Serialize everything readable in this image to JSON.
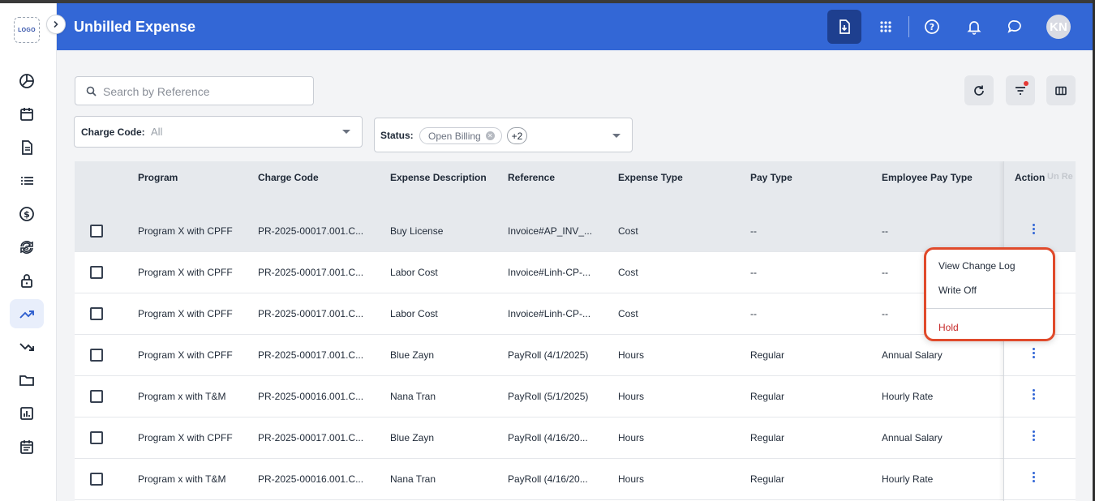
{
  "header": {
    "title": "Unbilled Expense",
    "avatar_initials": "KN",
    "accent_color": "#3367d6"
  },
  "sidebar": {
    "logo_text": "LOGO",
    "items": [
      {
        "icon": "pie-chart-icon"
      },
      {
        "icon": "calendar-icon"
      },
      {
        "icon": "document-icon"
      },
      {
        "icon": "list-icon"
      },
      {
        "icon": "dollar-icon"
      },
      {
        "icon": "currency-exchange-icon"
      },
      {
        "icon": "lock-icon"
      },
      {
        "icon": "trending-up-icon",
        "active": true
      },
      {
        "icon": "trending-down-icon"
      },
      {
        "icon": "folder-icon"
      },
      {
        "icon": "bar-report-icon"
      },
      {
        "icon": "schedule-icon"
      }
    ]
  },
  "search": {
    "placeholder": "Search by Reference",
    "value": ""
  },
  "filters": {
    "charge_code": {
      "label": "Charge Code:",
      "value": "All"
    },
    "status": {
      "label": "Status:",
      "chip": "Open Billing",
      "more": "+2"
    }
  },
  "table": {
    "columns": [
      "Program",
      "Charge Code",
      "Expense Description",
      "Reference",
      "Expense Type",
      "Pay Type",
      "Employee Pay Type",
      "Action"
    ],
    "hidden_column_hint": "Un Re",
    "rows": [
      {
        "program": "Program X with CPFF",
        "charge_code": "PR-2025-00017.001.C...",
        "description": "Buy License",
        "reference": "Invoice#AP_INV_...",
        "expense_type": "Cost",
        "pay_type": "--",
        "employee_pay_type": "--"
      },
      {
        "program": "Program X with CPFF",
        "charge_code": "PR-2025-00017.001.C...",
        "description": "Labor Cost",
        "reference": "Invoice#Linh-CP-...",
        "expense_type": "Cost",
        "pay_type": "--",
        "employee_pay_type": "--"
      },
      {
        "program": "Program X with CPFF",
        "charge_code": "PR-2025-00017.001.C...",
        "description": "Labor Cost",
        "reference": "Invoice#Linh-CP-...",
        "expense_type": "Cost",
        "pay_type": "--",
        "employee_pay_type": "--"
      },
      {
        "program": "Program X with CPFF",
        "charge_code": "PR-2025-00017.001.C...",
        "description": "Blue Zayn",
        "reference": "PayRoll (4/1/2025)",
        "expense_type": "Hours",
        "pay_type": "Regular",
        "employee_pay_type": "Annual Salary"
      },
      {
        "program": "Program x with T&M",
        "charge_code": "PR-2025-00016.001.C...",
        "description": "Nana Tran",
        "reference": "PayRoll (5/1/2025)",
        "expense_type": "Hours",
        "pay_type": "Regular",
        "employee_pay_type": "Hourly Rate"
      },
      {
        "program": "Program X with CPFF",
        "charge_code": "PR-2025-00017.001.C...",
        "description": "Blue Zayn",
        "reference": "PayRoll (4/16/20...",
        "expense_type": "Hours",
        "pay_type": "Regular",
        "employee_pay_type": "Annual Salary"
      },
      {
        "program": "Program x with T&M",
        "charge_code": "PR-2025-00016.001.C...",
        "description": "Nana Tran",
        "reference": "PayRoll (4/16/20...",
        "expense_type": "Hours",
        "pay_type": "Regular",
        "employee_pay_type": "Hourly Rate"
      }
    ]
  },
  "context_menu": {
    "items": [
      "View Change Log",
      "Write Off",
      "Hold"
    ],
    "danger_color": "#c62828",
    "highlight_color": "#e04a2b"
  }
}
